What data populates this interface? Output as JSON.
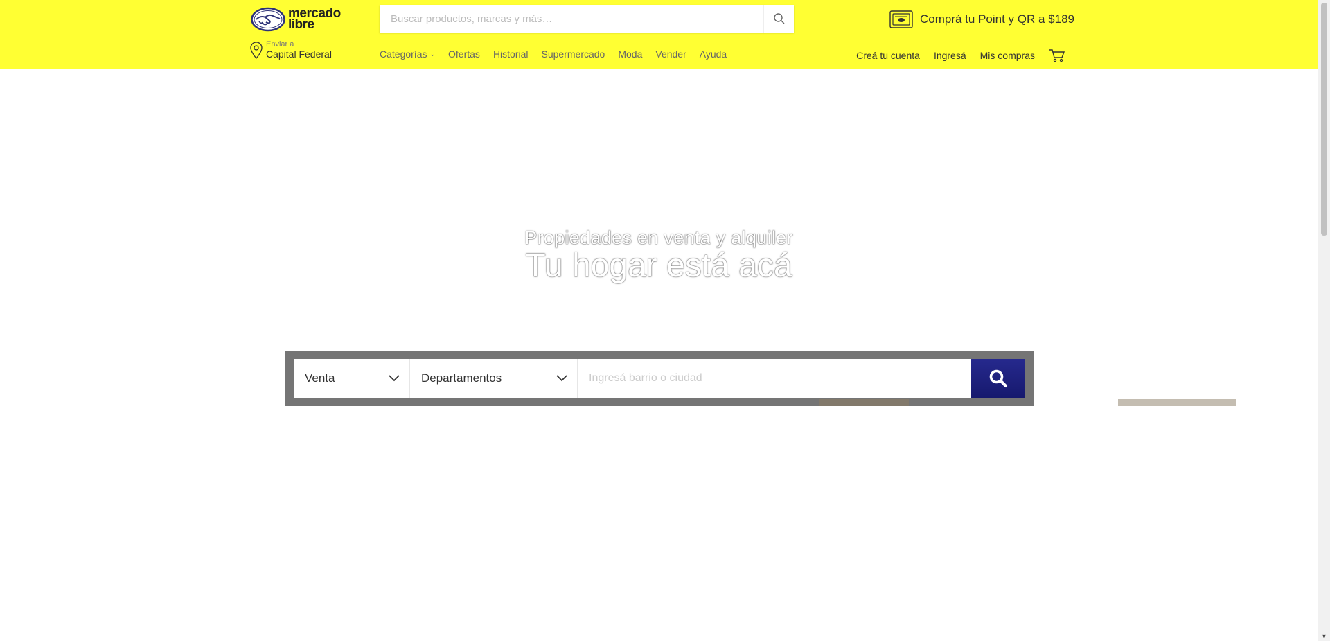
{
  "header": {
    "logo_line1": "mercado",
    "logo_line2": "libre",
    "search_placeholder": "Buscar productos, marcas y más…",
    "promo_text": "Comprá tu Point y QR a $189",
    "location_label": "Enviar a",
    "location_city": "Capital Federal",
    "nav": [
      "Categorías",
      "Ofertas",
      "Historial",
      "Supermercado",
      "Moda",
      "Vender",
      "Ayuda"
    ],
    "account": [
      "Creá tu cuenta",
      "Ingresá",
      "Mis compras"
    ]
  },
  "hero": {
    "subtitle": "Propiedades en venta y alquiler",
    "title": "Tu hogar está acá"
  },
  "property_search": {
    "operation_value": "Venta",
    "type_value": "Departamentos",
    "place_placeholder": "Ingresá barrio o ciudad"
  },
  "colors": {
    "header_bg": "#ffff33",
    "search_button": "#1b1f7a"
  },
  "icons": [
    "search-icon",
    "location-pin-icon",
    "point-device-icon",
    "cart-icon",
    "chevron-down-icon"
  ]
}
